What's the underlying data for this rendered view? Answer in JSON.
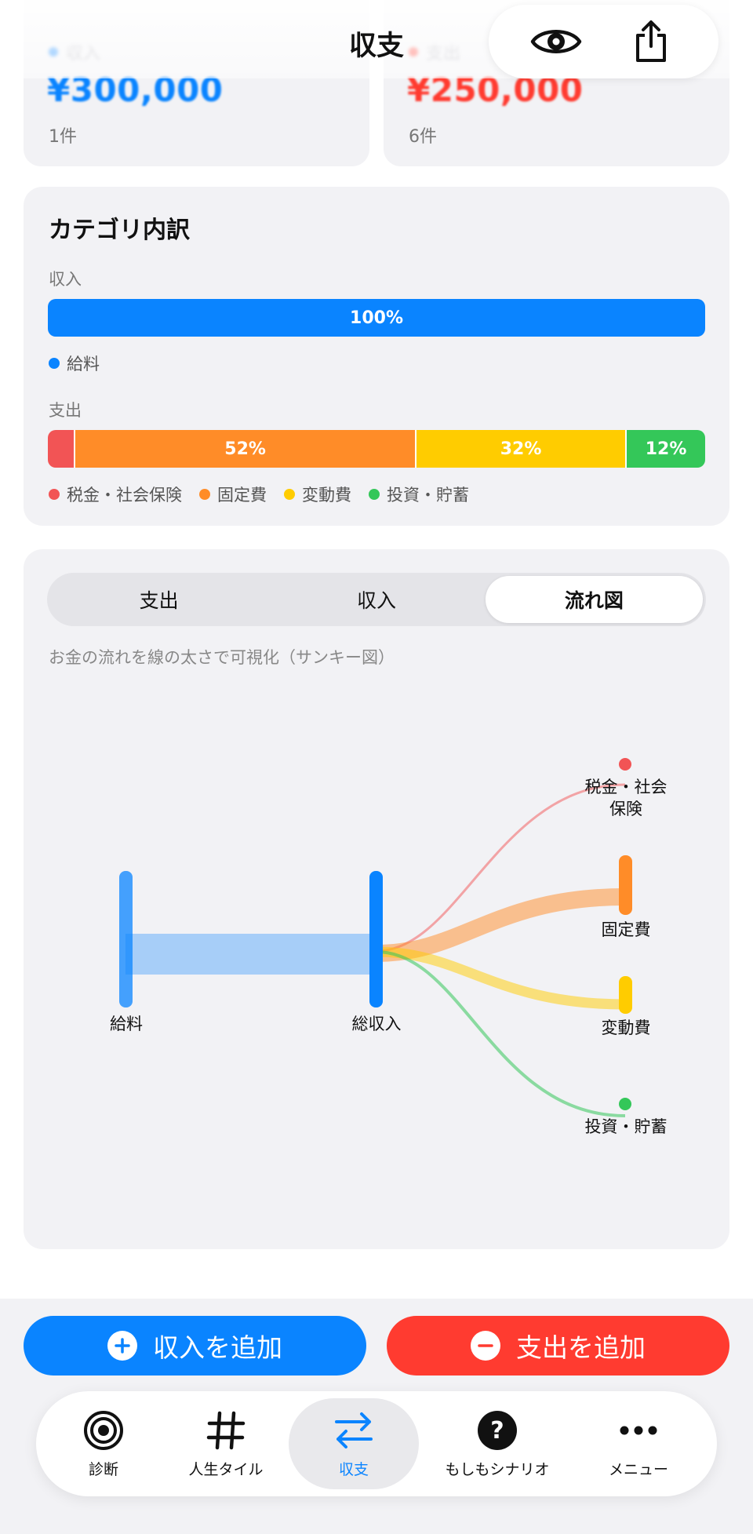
{
  "header": {
    "title": "収支"
  },
  "summary": {
    "income": {
      "label": "収入",
      "amount": "¥300,000",
      "count": "1件"
    },
    "expense": {
      "label": "支出",
      "amount": "¥250,000",
      "count": "6件"
    }
  },
  "breakdown": {
    "title": "カテゴリ内訳",
    "income_label": "収入",
    "income_bar": [
      {
        "label": "100%",
        "value": 100,
        "color": "#0a84ff"
      }
    ],
    "income_legend": [
      {
        "label": "給料",
        "color": "#0a84ff"
      }
    ],
    "expense_label": "支出",
    "expense_bar": [
      {
        "label": "",
        "value": 4,
        "color": "#f25455"
      },
      {
        "label": "52%",
        "value": 52,
        "color": "#ff8c28"
      },
      {
        "label": "32%",
        "value": 32,
        "color": "#ffcc00"
      },
      {
        "label": "12%",
        "value": 12,
        "color": "#34c759"
      }
    ],
    "expense_legend": [
      {
        "label": "税金・社会保険",
        "color": "#f25455"
      },
      {
        "label": "固定費",
        "color": "#ff8c28"
      },
      {
        "label": "変動費",
        "color": "#ffcc00"
      },
      {
        "label": "投資・貯蓄",
        "color": "#34c759"
      }
    ]
  },
  "flow": {
    "tabs": [
      {
        "label": "支出",
        "active": false
      },
      {
        "label": "収入",
        "active": false
      },
      {
        "label": "流れ図",
        "active": true
      }
    ],
    "description": "お金の流れを線の太さで可視化（サンキー図）",
    "nodes": {
      "salary": "給料",
      "total_income": "総収入",
      "tax_line1": "税金・社会",
      "tax_line2": "保険",
      "fixed": "固定費",
      "variable": "変動費",
      "invest": "投資・貯蓄"
    }
  },
  "actions": {
    "add_income": "収入を追加",
    "add_expense": "支出を追加"
  },
  "tabbar": [
    {
      "label": "診断",
      "icon": "target-icon",
      "active": false
    },
    {
      "label": "人生タイル",
      "icon": "grid-icon",
      "active": false
    },
    {
      "label": "収支",
      "icon": "arrows-icon",
      "active": true
    },
    {
      "label": "もしもシナリオ",
      "icon": "question-icon",
      "active": false
    },
    {
      "label": "メニュー",
      "icon": "more-icon",
      "active": false
    }
  ],
  "colors": {
    "accent": "#0a84ff",
    "danger": "#ff3b30",
    "income_bar": "#0a84ff"
  }
}
